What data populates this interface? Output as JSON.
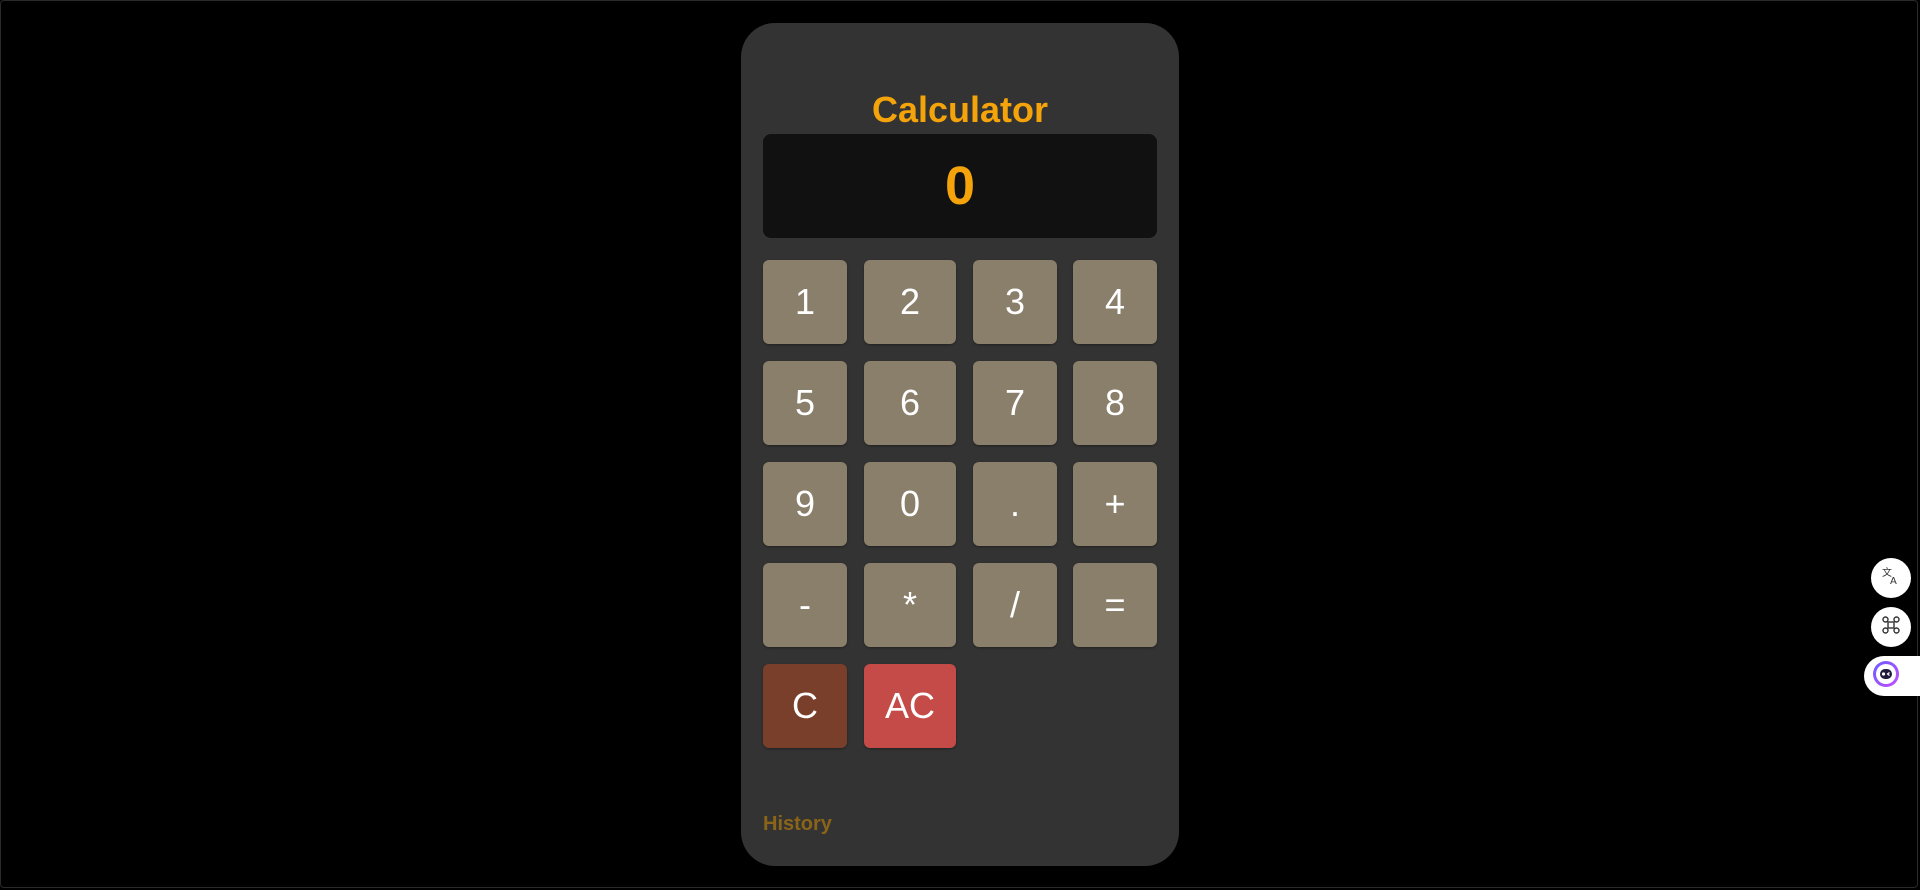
{
  "calculator": {
    "title": "Calculator",
    "display_value": "0",
    "history_label": "History",
    "keys": {
      "k1": "1",
      "k2": "2",
      "k3": "3",
      "k4": "4",
      "k5": "5",
      "k6": "6",
      "k7": "7",
      "k8": "8",
      "k9": "9",
      "k0": "0",
      "dot": ".",
      "plus": "+",
      "minus": "-",
      "multiply": "*",
      "divide": "/",
      "equals": "=",
      "clear": "C",
      "all_clear": "AC"
    }
  },
  "colors": {
    "accent": "#f5a30b",
    "key": "#8a7f6b",
    "clear_key": "#7a3f2a",
    "all_clear_key": "#c44b48",
    "panel": "#333333",
    "display": "#111111",
    "history": "#8a6418"
  },
  "side_tools": {
    "icons": [
      "translate-icon",
      "command-icon",
      "assistant-icon"
    ]
  }
}
